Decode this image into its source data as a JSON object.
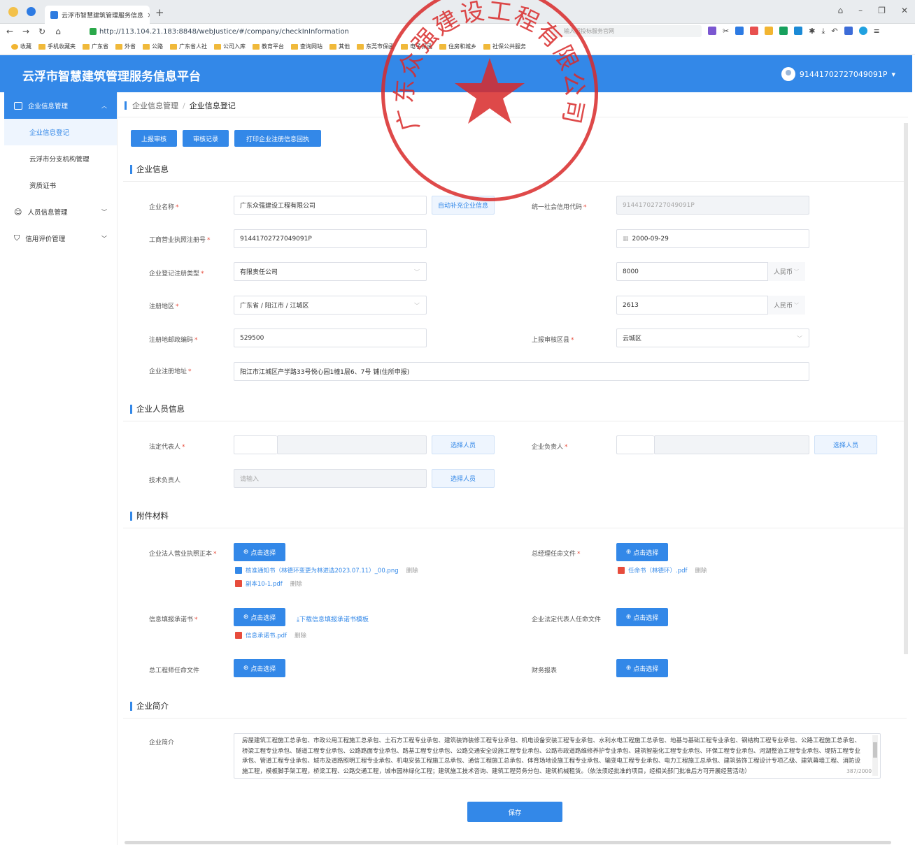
{
  "browser": {
    "tab_title": "云浮市智慧建筑管理服务信息",
    "url": "http://113.104.21.183:8848/webJustice/#/company/checkInInformation",
    "search_placeholder": "输入招投标服务官网",
    "bookmarks": [
      "收藏",
      "手机收藏夹",
      "广东省",
      "外省",
      "公路",
      "广东省人社",
      "公司入库",
      "教育平台",
      "查询网站",
      "其他",
      "东莞市保函",
      "电子保函",
      "住房和城乡",
      "社保公共服务"
    ]
  },
  "header": {
    "title": "云浮市智慧建筑管理服务信息平台",
    "user": "91441702727049091P"
  },
  "sidebar": {
    "groups": [
      {
        "label": "企业信息管理",
        "icon": "building-icon"
      },
      {
        "label": "人员信息管理",
        "icon": "users-icon"
      },
      {
        "label": "信用评价管理",
        "icon": "shield-icon"
      }
    ],
    "sub_items": [
      "企业信息登记",
      "云浮市分支机构管理",
      "资质证书"
    ]
  },
  "breadcrumb": {
    "parent": "企业信息管理",
    "sep": "/",
    "current": "企业信息登记"
  },
  "toolbar": {
    "submit": "上报审核",
    "records": "审核记录",
    "print": "打印企业注册信息回执"
  },
  "sections": {
    "info": "企业信息",
    "people": "企业人员信息",
    "attach": "附件材料",
    "intro": "企业简介"
  },
  "form": {
    "name_label": "企业名称",
    "name_value": "广东众强建设工程有限公司",
    "autofill": "自动补充企业信息",
    "credit_label": "统一社会信用代码",
    "credit_value": "91441702727049091P",
    "license_label": "工商营业执照注册号",
    "license_value": "91441702727049091P",
    "date_value": "2000-09-29",
    "type_label": "企业登记注册类型",
    "type_value": "有限责任公司",
    "capital_value": "8000",
    "capital_unit": "人民币",
    "region_label": "注册地区",
    "region_value": "广东省 / 阳江市 / 江城区",
    "capital2_value": "2613",
    "capital2_unit": "人民币",
    "post_label": "注册地邮政编码",
    "post_value": "529500",
    "district_label": "上报审核区县",
    "district_value": "云城区",
    "address_label": "企业注册地址",
    "address_value": "阳江市江城区产学路33号悦心园1幢1层6、7号 铺(住所申报)",
    "legal_label": "法定代表人",
    "select_person": "选择人员",
    "leader_label": "企业负责人",
    "tech_label": "技术负责人",
    "tech_placeholder": "请输入"
  },
  "attach": {
    "upload_label": "点击选择",
    "delete": "删除",
    "license_label": "企业法人营业执照正本",
    "license_files": [
      "核准通知书（林德环变更为林进选2023.07.11）_00.png",
      "副本10-1.pdf"
    ],
    "gm_label": "总经理任命文件",
    "gm_files": [
      "任命书（林德环）.pdf"
    ],
    "promise_label": "信息填报承诺书",
    "promise_template": "下载信息填报承诺书模板",
    "promise_files": [
      "信息承诺书.pdf"
    ],
    "legal_appoint_label": "企业法定代表人任命文件",
    "engineer_label": "总工程师任命文件",
    "finance_label": "财务报表"
  },
  "intro": {
    "label": "企业简介",
    "text": "房屋建筑工程施工总承包、市政公用工程施工总承包、土石方工程专业承包、建筑装饰装修工程专业承包、机电设备安装工程专业承包、水利水电工程施工总承包、地基与基础工程专业承包、钢结构工程专业承包、公路工程施工总承包、桥梁工程专业承包、隧道工程专业承包、公路路面专业承包、路基工程专业承包、公路交通安全设施工程专业承包、公路市政道路维修养护专业承包、建筑智能化工程专业承包、环保工程专业承包、河湖整治工程专业承包、堤防工程专业承包、管道工程专业承包、城市及道路照明工程专业承包、机电安装工程施工总承包、通信工程施工总承包、体育场地设施工程专业承包、输变电工程专业承包、电力工程施工总承包、建筑装饰工程设计专项乙级、建筑幕墙工程、消防设施工程，模板脚手架工程，桥梁工程、公路交通工程，城市园林绿化工程；建筑施工技术咨询、建筑工程劳务分包、建筑机械租赁。（依法须经批准的项目，经相关部门批准后方可开展经营活动）",
    "counter": "387/2000"
  },
  "save_label": "保存",
  "seal": {
    "text": "广东众强建设工程有限公司"
  },
  "colors": {
    "primary": "#3388e8",
    "required": "#e74c3c",
    "seal": "#d92a2a"
  }
}
